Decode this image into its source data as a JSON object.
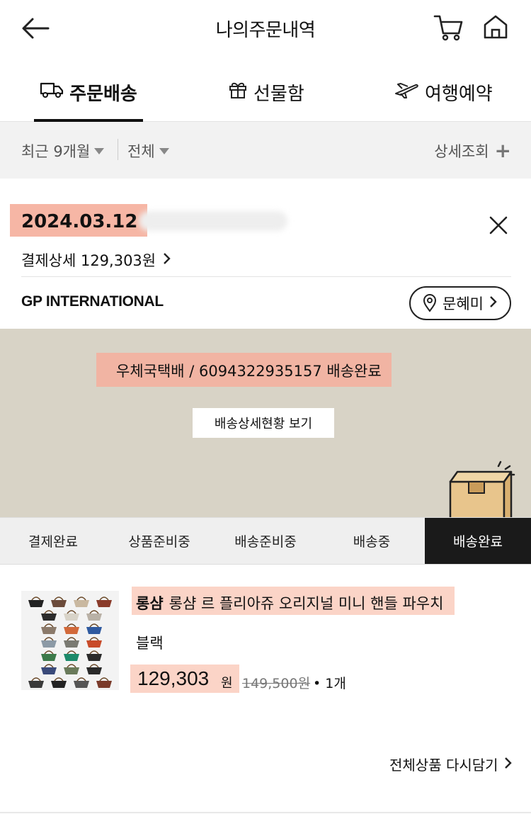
{
  "header": {
    "title": "나의주문내역"
  },
  "tabs": [
    {
      "label": "주문배송",
      "icon": "truck-icon",
      "active": true
    },
    {
      "label": "선물함",
      "icon": "gift-icon"
    },
    {
      "label": "여행예약",
      "icon": "airplane-icon"
    }
  ],
  "filters": {
    "period": "최근 9개월",
    "type": "전체",
    "detail": "상세조회"
  },
  "order": {
    "date": "2024.03.12",
    "payment_detail": "결제상세 129,303원",
    "seller": "GP INTERNATIONAL",
    "recipient": "문혜미",
    "tracking_text": "우체국택배 / 6094322935157 배송완료",
    "tracking_button": "배송상세현황 보기"
  },
  "steps": [
    {
      "label": "결제완료"
    },
    {
      "label": "상품준비중"
    },
    {
      "label": "배송준비중"
    },
    {
      "label": "배송중"
    },
    {
      "label": "배송완료",
      "active": true
    }
  ],
  "product": {
    "brand": "롱샴",
    "name": "롱샴 르 플리아쥬 오리지널 미니 핸들 파우치",
    "option": "블랙",
    "price": "129,303",
    "price_unit": "원",
    "original_price": "149,500",
    "original_unit": "원",
    "quantity": "• 1개"
  },
  "actions": {
    "rebuy_all": "전체상품 다시담기"
  },
  "colors": {
    "accent_highlight": "#f6b6a5",
    "banner_bg": "#d8d3c6",
    "active_step": "#1a1a1a"
  }
}
